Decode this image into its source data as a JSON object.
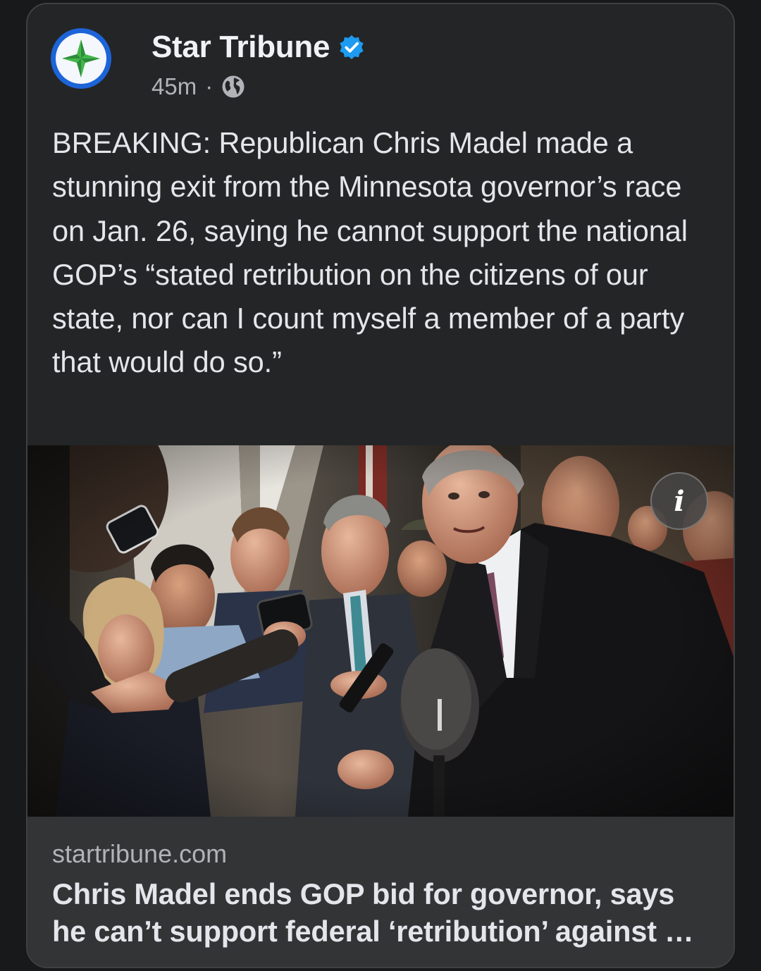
{
  "post": {
    "page_name": "Star Tribune",
    "timestamp": "45m",
    "separator": "·",
    "verified_icon": "verified-badge-icon",
    "privacy_icon": "globe-icon",
    "text": "BREAKING: Republican Chris Madel made a stunning exit from the Minnesota governor’s race on Jan. 26, saying he cannot support the national GOP’s “stated retribution on the citizens of our state, nor can I count myself a member of a party that would do so.”"
  },
  "photo": {
    "info_label": "i"
  },
  "link": {
    "domain": "startribune.com",
    "title": "Chris Madel ends GOP bid for governor, says he can’t support federal ‘retribution’ against …"
  },
  "colors": {
    "background": "#18191a",
    "card": "#242526",
    "link_preview": "#323436",
    "accent_blue": "#1c64d8",
    "logo_green": "#43b649"
  }
}
